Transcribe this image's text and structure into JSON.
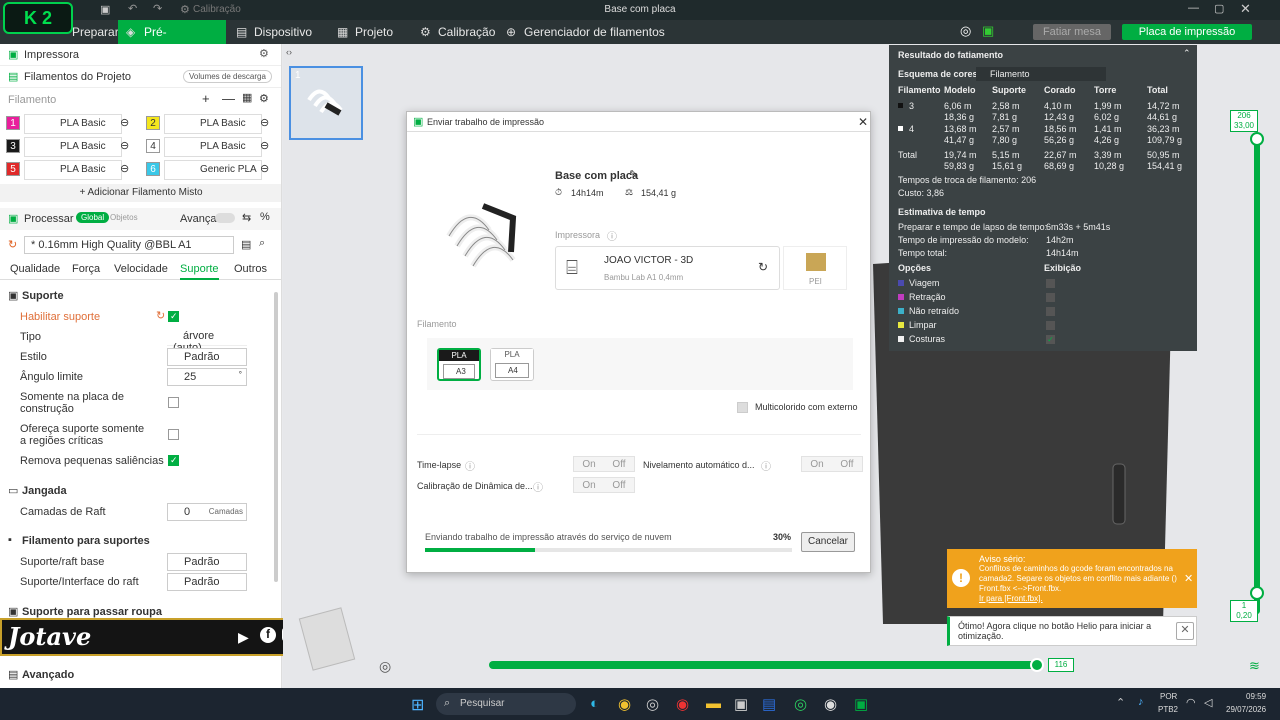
{
  "window": {
    "title": "Base com placa",
    "quick_item": "Calibração",
    "logo": "K 2"
  },
  "menu": {
    "prepare": "Preparar",
    "preview": "Pré-visualização",
    "device": "Dispositivo",
    "project": "Projeto",
    "calibration": "Calibração",
    "filament_manager": "Gerenciador de filamentos",
    "slice": "Fatiar mesa",
    "print_plate": "Placa de impressão"
  },
  "left": {
    "printer": "Impressora",
    "project_filaments": "Filamentos do Projeto",
    "purge_volumes": "Volumes de descarga",
    "filament_label": "Filamento",
    "filaments": [
      {
        "num": "1",
        "name": "PLA Basic",
        "color": "#e91e9c",
        "fg": "#fff"
      },
      {
        "num": "2",
        "name": "PLA Basic",
        "color": "#f4e61c",
        "fg": "#333"
      },
      {
        "num": "3",
        "name": "PLA Basic",
        "color": "#1a1a1a",
        "fg": "#fff"
      },
      {
        "num": "4",
        "name": "PLA Basic",
        "color": "#ffffff",
        "fg": "#333"
      },
      {
        "num": "5",
        "name": "PLA Basic",
        "color": "#e02a2a",
        "fg": "#fff"
      },
      {
        "num": "6",
        "name": "Generic PLA",
        "color": "#3ac8e8",
        "fg": "#fff"
      }
    ],
    "add_mixed": "+ Adicionar Filamento Misto",
    "process": "Processar",
    "global": "Global",
    "objects": "Objetos",
    "advanced": "Avançado",
    "profile": "* 0.16mm High Quality @BBL A1",
    "tabs": [
      "Qualidade",
      "Força",
      "Velocidade",
      "Suporte",
      "Outros"
    ],
    "support_title": "Suporte",
    "enable_support": "Habilitar suporte",
    "type_label": "Tipo",
    "type_value": "árvore (auto)",
    "style_label": "Estilo",
    "style_value": "Padrão",
    "threshold_label": "Ângulo limite",
    "threshold_value": "25",
    "threshold_unit": "°",
    "build_plate_only": "Somente na placa de construção",
    "critical_regions": "Ofereça suporte somente a regiões críticas",
    "remove_overhangs": "Remova pequenas saliências",
    "raft_title": "Jangada",
    "raft_layers_label": "Camadas de Raft",
    "raft_layers_value": "0",
    "raft_layers_unit": "Camadas",
    "support_filament_title": "Filamento para suportes",
    "support_base_label": "Suporte/raft base",
    "support_base_value": "Padrão",
    "support_iface_label": "Suporte/Interface do raft",
    "support_iface_value": "Padrão",
    "ironing_title": "Suporte para passar roupa",
    "advanced_title": "Avançado"
  },
  "overlay": {
    "brand": "Jotave"
  },
  "plate_thumb": {
    "num": "1"
  },
  "dialog": {
    "title": "Enviar trabalho de impressão",
    "model_name": "Base com placa",
    "time": "14h14m",
    "weight": "154,41 g",
    "printer_label": "Impressora",
    "printer_name": "JOAO VICTOR - 3D",
    "printer_model": "Bambu Lab A1  0,4mm",
    "plate": "PEI",
    "filament_label": "Filamento",
    "slots": [
      {
        "type": "PLA",
        "slot": "A3"
      },
      {
        "type": "PLA",
        "slot": "A4"
      }
    ],
    "multicolor": "Multicolorido com externo",
    "timelapse": "Time-lapse",
    "auto_level": "Nivelamento automático d...",
    "dynamics": "Calibração de Dinâmica de...",
    "on": "On",
    "off": "Off",
    "progress_text": "Enviando trabalho de impressão através do serviço de nuvem",
    "progress_pct": "30%",
    "progress_value": 30,
    "cancel": "Cancelar"
  },
  "result": {
    "title": "Resultado do fatiamento",
    "color_scheme": "Esquema de cores",
    "scheme_value": "Filamento",
    "headers": [
      "Filamento",
      "Modelo",
      "Suporte",
      "Corado",
      "Torre",
      "Total"
    ],
    "rows": [
      {
        "id": "3",
        "cells": [
          "6,06 m\n18,36 g",
          "2,58 m\n7,81 g",
          "4,10 m\n12,43 g",
          "1,99 m\n6,02 g",
          "14,72 m\n44,61 g"
        ]
      },
      {
        "id": "4",
        "cells": [
          "13,68 m\n41,47 g",
          "2,57 m\n7,80 g",
          "18,56 m\n56,26 g",
          "1,41 m\n4,26 g",
          "36,23 m\n109,79 g"
        ]
      },
      {
        "id": "Total",
        "cells": [
          "19,74 m\n59,83 g",
          "5,15 m\n15,61 g",
          "22,67 m\n68,69 g",
          "3,39 m\n10,28 g",
          "50,95 m\n154,41 g"
        ]
      }
    ],
    "changes": "Tempos de troca de filamento:  206",
    "cost": "Custo:  3,86",
    "time_title": "Estimativa de tempo",
    "timelapse_prep_label": "Preparar e tempo de lapso de tempo:",
    "timelapse_prep": "6m33s + 5m41s",
    "model_time_label": "Tempo de impressão do modelo:",
    "model_time": "14h2m",
    "total_time_label": "Tempo total:",
    "total_time": "14h14m",
    "options": "Opções",
    "display": "Exibição",
    "legend": [
      {
        "name": "Viagem",
        "color": "#4a4ab0"
      },
      {
        "name": "Retração",
        "color": "#c03cc0"
      },
      {
        "name": "Não retraído",
        "color": "#3cb0c8"
      },
      {
        "name": "Limpar",
        "color": "#e8e840"
      },
      {
        "name": "Costuras",
        "color": "#f0f0f0"
      }
    ]
  },
  "slider": {
    "top_layer": "206",
    "top_height": "33,00",
    "bottom_layer": "1",
    "bottom_height": "0,20",
    "h_value": "116"
  },
  "notices": {
    "warn_title": "Aviso sério:",
    "warn_text": "Conflitos de caminhos do gcode foram encontrados na camada2. Separe os objetos em conflito mais adiante () Front.fbx <-->Front.fbx.",
    "warn_link": "Ir para [Front.fbx].",
    "tip": "Ótimo! Agora clique no botão Helio para iniciar a otimização."
  },
  "taskbar": {
    "search": "Pesquisar",
    "lang": "POR",
    "layout": "PTB2",
    "time": "09:59",
    "date": "29/07/2026"
  }
}
